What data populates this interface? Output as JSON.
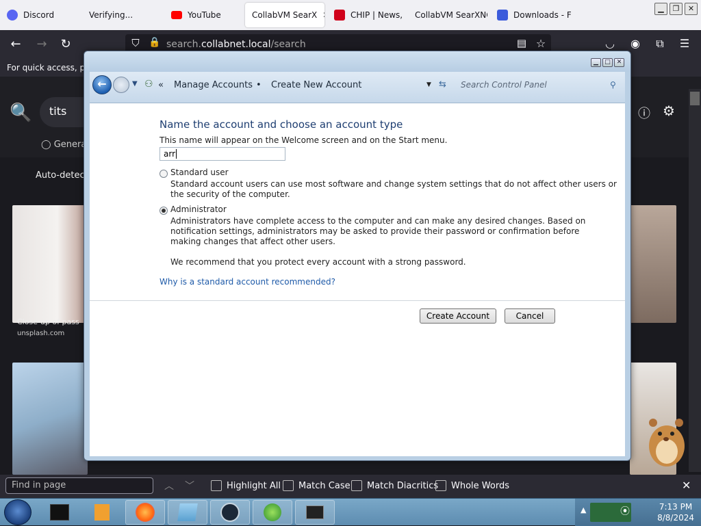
{
  "browser": {
    "tabs": [
      {
        "label": "Discord",
        "color": "#5865f2"
      },
      {
        "label": "Verifying...",
        "color": "#f0f0f4"
      },
      {
        "label": "YouTube",
        "color": "#ff0000"
      },
      {
        "label": "CollabVM SearX",
        "color": "#f0f0f4",
        "active": true
      },
      {
        "label": "CHIP | News, ",
        "color": "#d0021b"
      },
      {
        "label": "CollabVM SearXNG",
        "color": "#f0f0f4"
      },
      {
        "label": "Downloads - F",
        "color": "#3b5bdb"
      }
    ],
    "url_prefix": "search.",
    "url_domain": "collabnet.local",
    "url_suffix": "/search",
    "bookmarks_hint": "For quick access, plac",
    "search_query": "tits",
    "general_label": "Genera",
    "autodetect_label": "Auto-detect",
    "thumb_caption": "Close-up of pass",
    "thumb_source": "unsplash.com"
  },
  "findbar": {
    "placeholder": "Find in page",
    "highlight_all": "Highlight All",
    "match_case": "Match Case",
    "match_diacritics": "Match Diacritics",
    "whole_words": "Whole Words"
  },
  "dialog": {
    "breadcrumb_1": "Manage Accounts",
    "breadcrumb_2": "Create New Account",
    "search_placeholder": "Search Control Panel",
    "heading": "Name the account and choose an account type",
    "name_hint": "This name will appear on the Welcome screen and on the Start menu.",
    "name_value": "arr",
    "standard_label": "Standard user",
    "standard_desc_1": "Standard account users can use most software and change system settings that do not affect other users or",
    "standard_desc_2": "the security of the computer.",
    "admin_label": "Administrator",
    "admin_desc_1": "Administrators have complete access to the computer and can make any desired changes. Based on",
    "admin_desc_2": "notification settings, administrators may be asked to provide their password or confirmation before",
    "admin_desc_3": "making changes that affect other users.",
    "recommend": "We recommend that you protect every account with a strong password.",
    "why_link": "Why is a standard account recommended?",
    "create_button": "Create Account",
    "cancel_button": "Cancel",
    "selected_type": "Administrator"
  },
  "taskbar": {
    "time": "7:13 PM",
    "date": "8/8/2024"
  }
}
